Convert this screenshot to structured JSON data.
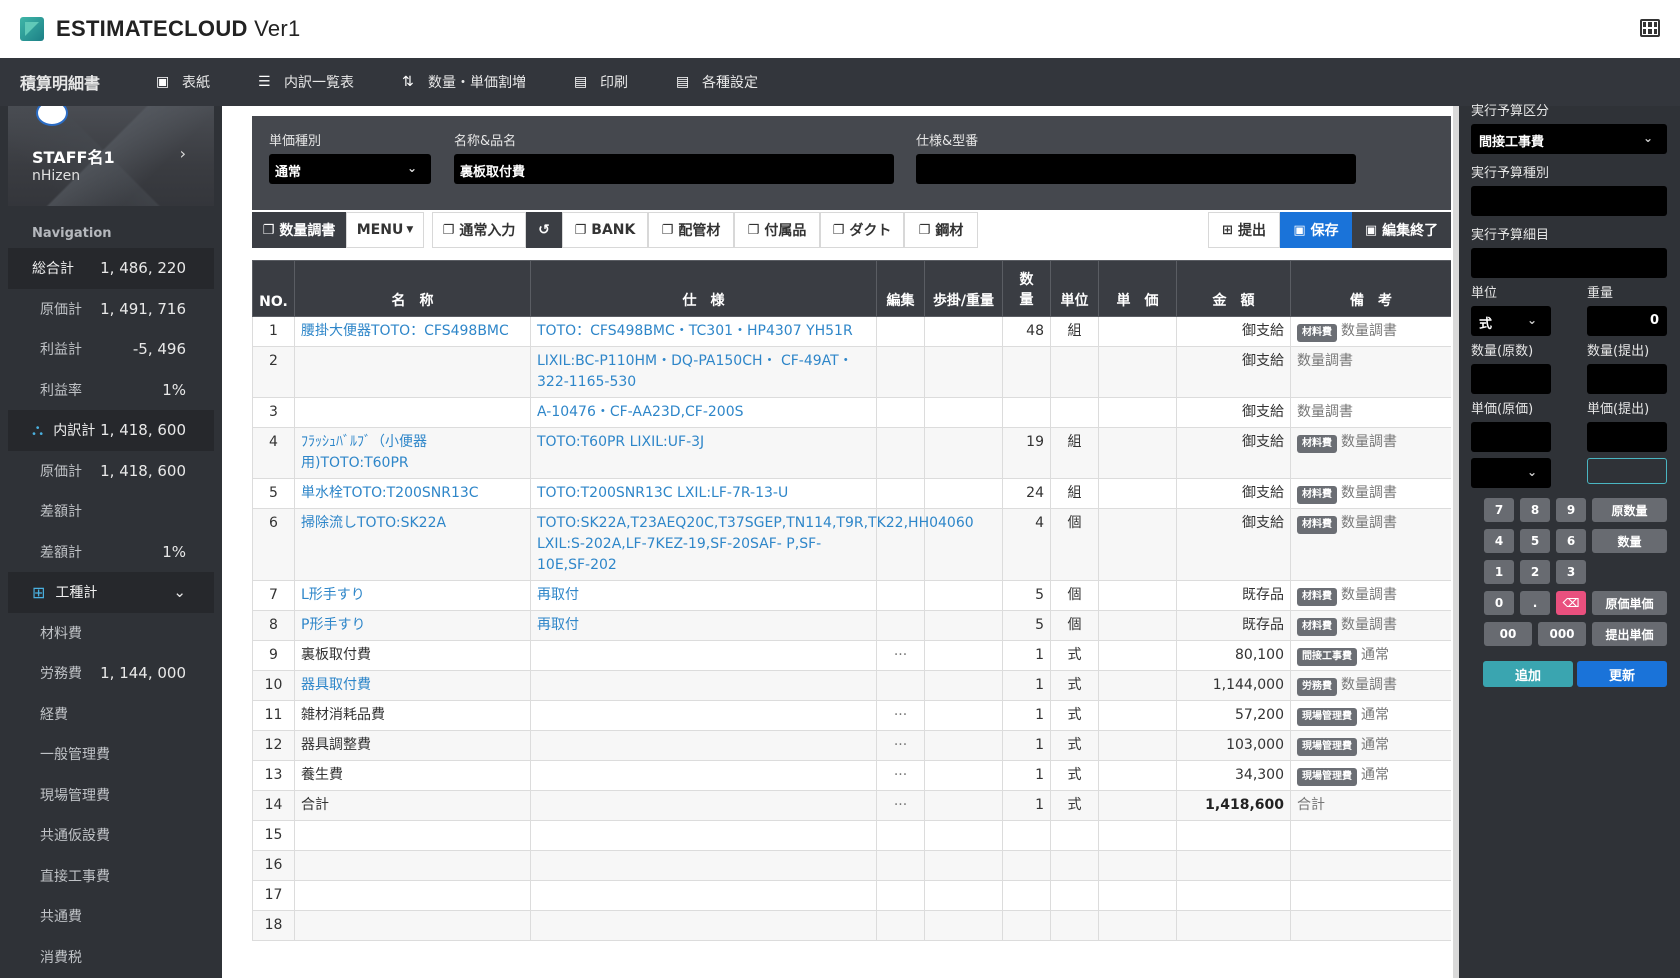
{
  "header": {
    "title_bold": "ESTIMATECLOUD",
    "title_rest": " Ver1"
  },
  "nav": {
    "brand": "積算明細書",
    "items": [
      {
        "label": "表紙",
        "icon": "id-card-icon"
      },
      {
        "label": "内訳一覧表",
        "icon": "list-icon"
      },
      {
        "label": "数量・単価割増",
        "icon": "sort-icon"
      },
      {
        "label": "印刷",
        "icon": "print-icon"
      },
      {
        "label": "各種設定",
        "icon": "settings-icon"
      }
    ]
  },
  "sidebar": {
    "staff_name": "STAFF名1",
    "staff_sub": "nHizen",
    "nav_label": "Navigation",
    "rows": [
      {
        "label": "総合計",
        "value": "1, 486, 220",
        "highlight": true
      },
      {
        "label": "原価計",
        "value": "1, 491, 716"
      },
      {
        "label": "利益計",
        "value": "-5, 496"
      },
      {
        "label": "利益率",
        "value": "1%"
      },
      {
        "label": "内訳計",
        "value": "1, 418, 600",
        "highlight": true,
        "icon": "sitemap-icon"
      },
      {
        "label": "原価計",
        "value": "1, 418, 600"
      },
      {
        "label": "差額計",
        "value": ""
      },
      {
        "label": "差額計",
        "value": "1%"
      },
      {
        "label": "工種計",
        "value": "",
        "highlight": true,
        "icon": "table-icon",
        "chevron": "⌄"
      },
      {
        "label": "材料費",
        "value": ""
      },
      {
        "label": "労務費",
        "value": "1, 144, 000"
      },
      {
        "label": "経費",
        "value": ""
      },
      {
        "label": "一般管理費",
        "value": ""
      },
      {
        "label": "現場管理費",
        "value": ""
      },
      {
        "label": "共通仮設費",
        "value": ""
      },
      {
        "label": "直接工事費",
        "value": ""
      },
      {
        "label": "共通費",
        "value": ""
      },
      {
        "label": "消費税",
        "value": ""
      }
    ]
  },
  "form": {
    "price_type_label": "単価種別",
    "price_type_value": "通常",
    "name_label": "名称&品名",
    "name_value": "裏板取付費",
    "spec_label": "仕様&型番",
    "spec_value": ""
  },
  "toolbar": {
    "qty_survey": "数量調書",
    "menu": "MENU",
    "normal_input": "通常入力",
    "bank": "BANK",
    "piping": "配管材",
    "accessories": "付属品",
    "duct": "ダクト",
    "steel": "鋼材",
    "submit": "提出",
    "save": "保存",
    "end_edit": "編集終了"
  },
  "table": {
    "headers": {
      "no": "NO.",
      "name": "名　称",
      "spec": "仕　様",
      "edit": "編集",
      "ratio": "歩掛/重量",
      "qty": "数\n量",
      "unit": "単位",
      "price": "単　価",
      "amount": "金　額",
      "note": "備　考"
    },
    "rows": [
      {
        "no": "1",
        "name": "腰掛大便器TOTO：CFS498BMC",
        "name_link": true,
        "spec": "TOTO：CFS498BMC・TC301・HP4307 YH51R",
        "edit": "",
        "qty": "48",
        "unit": "組",
        "amount": "御支給",
        "badge": "材料費",
        "note": "数量調書"
      },
      {
        "no": "2",
        "name": "",
        "spec": "LIXIL:BC-P110HM・DQ-PA150CH・ CF-49AT・322-1165-530",
        "edit": "",
        "qty": "",
        "unit": "",
        "amount": "御支給",
        "badge": "",
        "note": "数量調書"
      },
      {
        "no": "3",
        "name": "",
        "spec": "A-10476・CF-AA23D,CF-200S",
        "edit": "",
        "qty": "",
        "unit": "",
        "amount": "御支給",
        "badge": "",
        "note": "数量調書"
      },
      {
        "no": "4",
        "name": "ﾌﾗｯｼｭﾊﾞﾙﾌﾞ（小便器用)TOTO:T60PR",
        "name_link": true,
        "spec": "TOTO:T60PR LIXIL:UF-3J",
        "edit": "",
        "qty": "19",
        "unit": "組",
        "amount": "御支給",
        "badge": "材料費",
        "note": "数量調書"
      },
      {
        "no": "5",
        "name": "単水栓TOTO:T200SNR13C",
        "name_link": true,
        "spec": "TOTO:T200SNR13C LXIL:LF-7R-13-U",
        "edit": "",
        "qty": "24",
        "unit": "組",
        "amount": "御支給",
        "badge": "材料費",
        "note": "数量調書"
      },
      {
        "no": "6",
        "name": "掃除流しTOTO:SK22A",
        "name_link": true,
        "spec": "TOTO:SK22A,T23AEQ20C,T37SGEP,TN114,T9R,TK22,HH04060 LXIL:S-202A,LF-7KEZ-19,SF-20SAF- P,SF-10E,SF-202",
        "edit": "",
        "qty": "4",
        "unit": "個",
        "amount": "御支給",
        "badge": "材料費",
        "note": "数量調書"
      },
      {
        "no": "7",
        "name": "L形手すり",
        "name_link": true,
        "spec": "再取付",
        "edit": "",
        "qty": "5",
        "unit": "個",
        "amount": "既存品",
        "badge": "材料費",
        "note": "数量調書"
      },
      {
        "no": "8",
        "name": "P形手すり",
        "name_link": true,
        "spec": "再取付",
        "edit": "",
        "qty": "5",
        "unit": "個",
        "amount": "既存品",
        "badge": "材料費",
        "note": "数量調書"
      },
      {
        "no": "9",
        "name": "裏板取付費",
        "spec": "",
        "edit": "···",
        "qty": "1",
        "unit": "式",
        "amount": "80,100",
        "badge": "間接工事費",
        "note": "通常"
      },
      {
        "no": "10",
        "name": "器具取付費",
        "name_link": true,
        "spec": "",
        "edit": "",
        "qty": "1",
        "unit": "式",
        "amount": "1,144,000",
        "badge": "労務費",
        "note": "数量調書"
      },
      {
        "no": "11",
        "name": "雑材消耗品費",
        "spec": "",
        "edit": "···",
        "qty": "1",
        "unit": "式",
        "amount": "57,200",
        "badge": "現場管理費",
        "note": "通常"
      },
      {
        "no": "12",
        "name": "器具調整費",
        "spec": "",
        "edit": "···",
        "qty": "1",
        "unit": "式",
        "amount": "103,000",
        "badge": "現場管理費",
        "note": "通常"
      },
      {
        "no": "13",
        "name": "養生費",
        "spec": "",
        "edit": "···",
        "qty": "1",
        "unit": "式",
        "amount": "34,300",
        "badge": "現場管理費",
        "note": "通常"
      },
      {
        "no": "14",
        "name": "合計",
        "spec": "",
        "edit": "···",
        "qty": "1",
        "unit": "式",
        "amount": "1,418,600",
        "amount_bold": true,
        "badge": "",
        "note": "合計"
      },
      {
        "no": "15",
        "name": "",
        "spec": "",
        "edit": "",
        "qty": "",
        "unit": "",
        "amount": "",
        "badge": "",
        "note": ""
      },
      {
        "no": "16",
        "name": "",
        "spec": "",
        "edit": "",
        "qty": "",
        "unit": "",
        "amount": "",
        "badge": "",
        "note": ""
      },
      {
        "no": "17",
        "name": "",
        "spec": "",
        "edit": "",
        "qty": "",
        "unit": "",
        "amount": "",
        "badge": "",
        "note": ""
      },
      {
        "no": "18",
        "name": "",
        "spec": "",
        "edit": "",
        "qty": "",
        "unit": "",
        "amount": "",
        "badge": "",
        "note": ""
      }
    ]
  },
  "right": {
    "budget_class_label": "実行予算区分",
    "budget_class_value": "間接工事費",
    "budget_type_label": "実行予算種別",
    "budget_detail_label": "実行予算細目",
    "unit_label": "単位",
    "unit_value": "式",
    "weight_label": "重量",
    "weight_value": "0",
    "qty_orig_label": "数量(原数)",
    "qty_sub_label": "数量(提出)",
    "price_orig_label": "単価(原価)",
    "price_sub_label": "単価(提出)",
    "keys": {
      "k7": "7",
      "k8": "8",
      "k9": "9",
      "k4": "4",
      "k5": "5",
      "k6": "6",
      "k1": "1",
      "k2": "2",
      "k3": "3",
      "k0": "0",
      "kdot": ".",
      "k00": "00",
      "k000": "000",
      "orig_qty": "原数量",
      "qty": "数量",
      "orig_price": "原価単価",
      "sub_price": "提出単価"
    },
    "add": "追加",
    "update": "更新"
  },
  "colors": {
    "link": "#2e86c9",
    "accent_blue": "#1a73d9",
    "teal": "#3aa5b0",
    "pink": "#e9507e"
  }
}
